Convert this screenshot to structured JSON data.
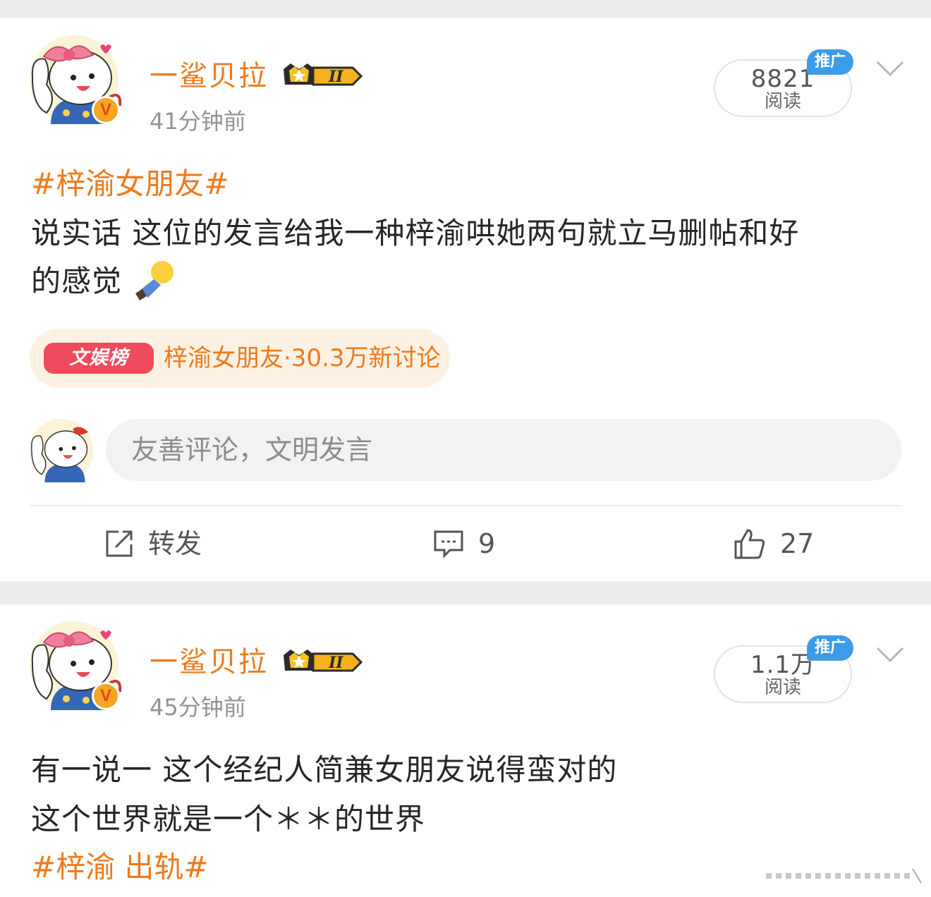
{
  "posts": [
    {
      "username": "一鲨贝拉",
      "timestamp": "41分钟前",
      "reads_count": "8821",
      "reads_label": "阅读",
      "promo_tag": "推广",
      "hashtag": "#梓渝女朋友#",
      "body_lines": [
        "说实话 这位的发言给我一种梓渝哄她两句就立马删帖和好",
        "的感觉"
      ],
      "trend": {
        "badge": "文娱榜",
        "text": "梓渝女朋友·30.3万新讨论"
      },
      "comment_placeholder": "友善评论，文明发言",
      "actions": {
        "repost_label": "转发",
        "comment_count": "9",
        "like_count": "27"
      }
    },
    {
      "username": "一鲨贝拉",
      "timestamp": "45分钟前",
      "reads_count": "1.1万",
      "reads_label": "阅读",
      "promo_tag": "推广",
      "body_lines": [
        "有一说一 这个经纪人简兼女朋友说得蛮对的",
        "这个世界就是一个＊＊的世界"
      ],
      "hashtag": "#梓渝 出轨#"
    }
  ],
  "colors": {
    "accent": "#ee7a1b",
    "promo": "#3d9be8",
    "trend_badge": "#f04a5d",
    "trend_bg": "#fdf1e4"
  },
  "icons": [
    "repost-icon",
    "comment-icon",
    "like-icon",
    "chevron-down-icon",
    "crown-badge-icon",
    "verified-badge-icon"
  ]
}
